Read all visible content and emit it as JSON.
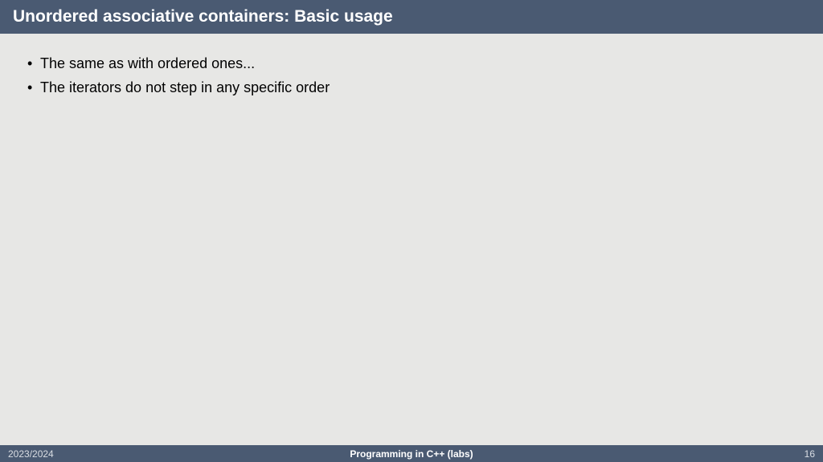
{
  "header": {
    "title": "Unordered associative containers: Basic usage"
  },
  "content": {
    "bullets": [
      "The same as with ordered ones...",
      "The iterators do not step in any specific order"
    ]
  },
  "footer": {
    "left": "2023/2024",
    "center": "Programming in C++ (labs)",
    "right": "16"
  }
}
